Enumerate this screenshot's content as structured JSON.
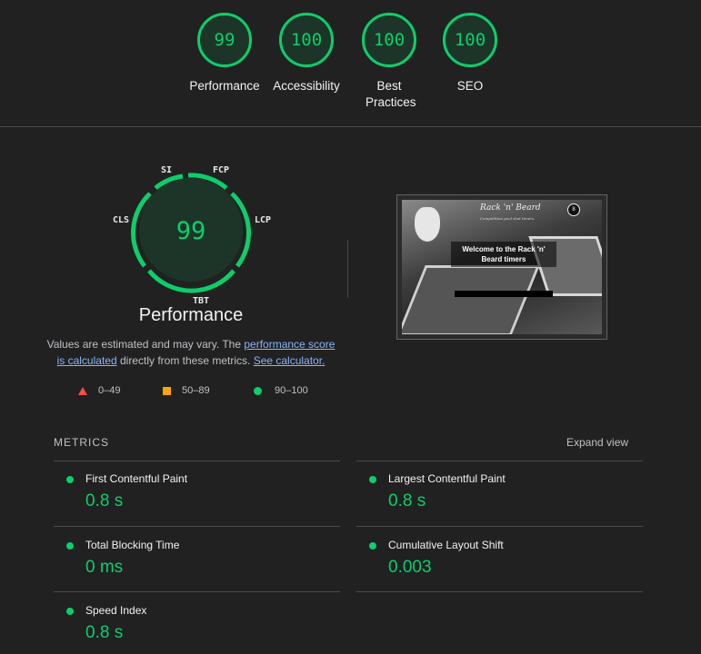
{
  "colors": {
    "pass": "#0cce6b",
    "average": "#ffa400",
    "fail": "#ff4e42",
    "link": "#8ab4f8"
  },
  "categories": [
    {
      "score": "99",
      "label": "Performance"
    },
    {
      "score": "100",
      "label": "Accessibility"
    },
    {
      "score": "100",
      "label": "Best Practices"
    },
    {
      "score": "100",
      "label": "SEO"
    }
  ],
  "performance": {
    "score": "99",
    "title": "Performance",
    "gauge_labels": {
      "si": "SI",
      "fcp": "FCP",
      "lcp": "LCP",
      "tbt": "TBT",
      "cls": "CLS"
    },
    "note_prefix": "Values are estimated and may vary. The ",
    "note_link1": "performance score is calculated",
    "note_middle": " directly from these metrics. ",
    "note_link2": "See calculator."
  },
  "legend": [
    {
      "range": "0–49",
      "icon": "triangle-icon"
    },
    {
      "range": "50–89",
      "icon": "square-icon"
    },
    {
      "range": "90–100",
      "icon": "circle-icon"
    }
  ],
  "screenshot": {
    "brand": "Rack 'n' Beard",
    "tagline": "Competition pool shot timers",
    "welcome": "Welcome to the Rack 'n' Beard timers",
    "ball_number": "8"
  },
  "metrics": {
    "header": "METRICS",
    "expand_label": "Expand view",
    "items": [
      {
        "label": "First Contentful Paint",
        "value": "0.8 s"
      },
      {
        "label": "Largest Contentful Paint",
        "value": "0.8 s"
      },
      {
        "label": "Total Blocking Time",
        "value": "0 ms"
      },
      {
        "label": "Cumulative Layout Shift",
        "value": "0.003"
      },
      {
        "label": "Speed Index",
        "value": "0.8 s"
      }
    ]
  }
}
